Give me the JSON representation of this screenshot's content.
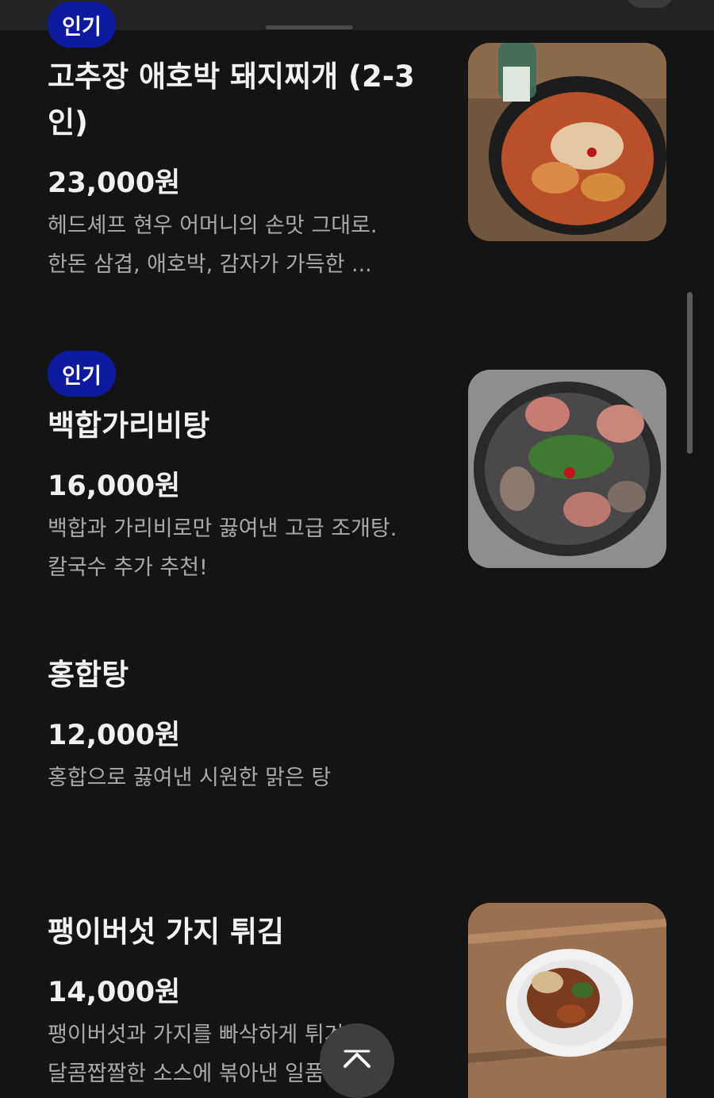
{
  "menu": {
    "items": [
      {
        "badge": "인기",
        "name_line1": "고추장 애호박 돼지찌개 (2-3",
        "name_line2": "인)",
        "price": "23,000원",
        "desc_line1": "헤드셰프 현우 어머니의 손맛 그대로.",
        "desc_line2": "한돈 삼겹, 애호박, 감자가 가득한 ...",
        "photo_icon": "pork-stew-photo"
      },
      {
        "badge": "인기",
        "name": "백합가리비탕",
        "price": "16,000원",
        "desc_line1": "백합과 가리비로만 끓여낸 고급 조개탕.",
        "desc_line2": "칼국수 추가 추천!",
        "photo_icon": "clam-scallop-soup-photo"
      },
      {
        "name": "홍합탕",
        "price": "12,000원",
        "desc_line1": "홍합으로 끓여낸 시원한 맑은 탕"
      },
      {
        "name": "팽이버섯 가지 튀김",
        "price": "14,000원",
        "desc_line1": "팽이버섯과 가지를 빠삭하게 튀겨서",
        "desc_line2": "달콤짭짤한 소스에 볶아낸 일품 요리",
        "photo_icon": "fried-mushroom-eggplant-photo"
      }
    ]
  },
  "colors": {
    "background": "#141414",
    "badge": "#0d1aa0",
    "text_primary": "#f2f2f2",
    "text_secondary": "#a9a9a9"
  },
  "icons": {
    "scroll_top": "chevron-up-icon"
  }
}
